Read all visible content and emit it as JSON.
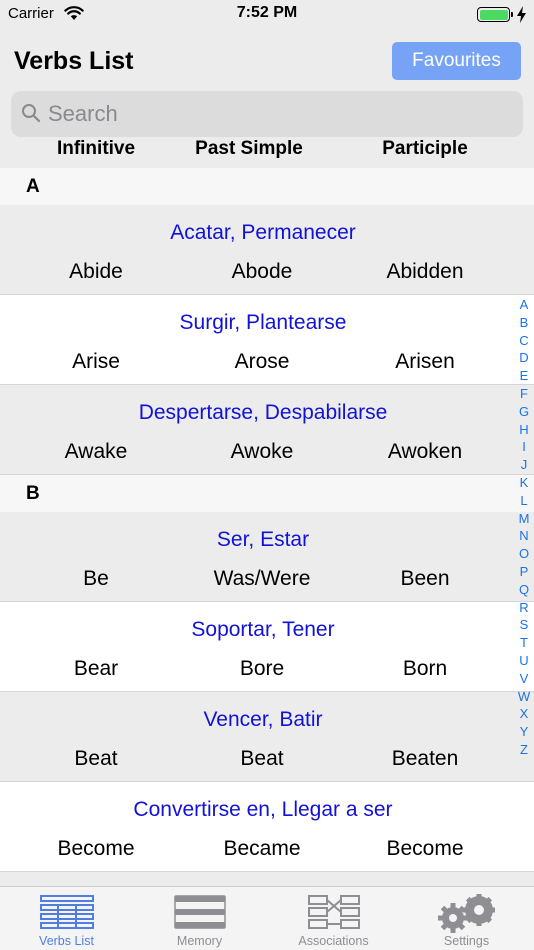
{
  "status_bar": {
    "carrier": "Carrier",
    "time": "7:52 PM",
    "battery_level": 1.0
  },
  "nav": {
    "title": "Verbs List",
    "favourites_label": "Favourites"
  },
  "search": {
    "placeholder": "Search"
  },
  "columns": {
    "infinitive": "Infinitive",
    "past_simple": "Past Simple",
    "participle": "Participle"
  },
  "sections": [
    {
      "letter": "A",
      "rows": [
        {
          "meaning": "Acatar, Permanecer",
          "infinitive": "Abide",
          "past": "Abode",
          "participle": "Abidden"
        },
        {
          "meaning": "Surgir, Plantearse",
          "infinitive": "Arise",
          "past": "Arose",
          "participle": "Arisen"
        },
        {
          "meaning": "Despertarse, Despabilarse",
          "infinitive": "Awake",
          "past": "Awoke",
          "participle": "Awoken"
        }
      ]
    },
    {
      "letter": "B",
      "rows": [
        {
          "meaning": "Ser, Estar",
          "infinitive": "Be",
          "past": "Was/Were",
          "participle": "Been"
        },
        {
          "meaning": "Soportar, Tener",
          "infinitive": "Bear",
          "past": "Bore",
          "participle": "Born"
        },
        {
          "meaning": "Vencer, Batir",
          "infinitive": "Beat",
          "past": "Beat",
          "participle": "Beaten"
        },
        {
          "meaning": "Convertirse en, Llegar a ser",
          "infinitive": "Become",
          "past": "Became",
          "participle": "Become"
        }
      ]
    }
  ],
  "index_letters": [
    "A",
    "B",
    "C",
    "D",
    "E",
    "F",
    "G",
    "H",
    "I",
    "J",
    "K",
    "L",
    "M",
    "N",
    "O",
    "P",
    "Q",
    "R",
    "S",
    "T",
    "U",
    "V",
    "W",
    "X",
    "Y",
    "Z"
  ],
  "tabs": [
    {
      "label": "Verbs List",
      "icon": "list-icon",
      "active": true
    },
    {
      "label": "Memory",
      "icon": "memory-icon",
      "active": false
    },
    {
      "label": "Associations",
      "icon": "associations-icon",
      "active": false
    },
    {
      "label": "Settings",
      "icon": "gears-icon",
      "active": false
    }
  ],
  "colors": {
    "accent": "#77a3f6",
    "meaning_text": "#1212d6",
    "index_text": "#1a73e8",
    "active_tab": "#4f7de0",
    "battery": "#4cd964"
  }
}
